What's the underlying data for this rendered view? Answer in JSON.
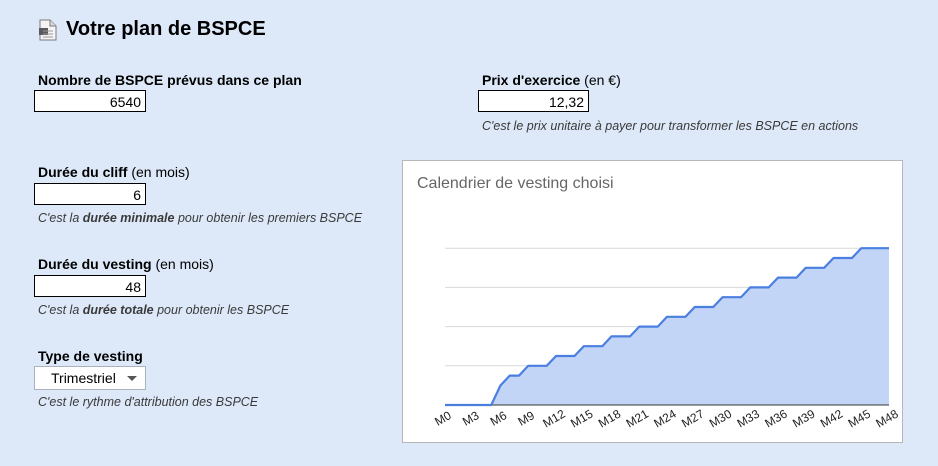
{
  "header": {
    "title": "Votre plan de BSPCE",
    "icon": "document-icon"
  },
  "fields": {
    "nb_bspce": {
      "label": "Nombre de BSPCE prévus dans ce plan",
      "value": "6540"
    },
    "prix": {
      "label": "Prix d'exercice",
      "label_suffix": " (en €)",
      "value": "12,32",
      "hint": "C'est le prix unitaire à payer pour transformer les BSPCE en actions"
    },
    "cliff": {
      "label": "Durée du cliff",
      "label_suffix": " (en mois)",
      "value": "6",
      "hint_pre": "C'est la ",
      "hint_bold": "durée minimale",
      "hint_post": " pour obtenir les premiers BSPCE"
    },
    "vesting": {
      "label": "Durée du vesting",
      "label_suffix": " (en mois)",
      "value": "48",
      "hint_pre": "C'est la ",
      "hint_bold": "durée totale",
      "hint_post": " pour obtenir les BSPCE"
    },
    "type": {
      "label": "Type de vesting",
      "value": "Trimestriel",
      "hint": "C'est le rythme d'attribution des BSPCE"
    }
  },
  "colors": {
    "line": "#4a7fe0",
    "fill": "#c3d5f7",
    "grid": "#d9d9d9",
    "background": "#dde8f8"
  },
  "chart_data": {
    "type": "area",
    "title": "Calendrier de vesting choisi",
    "xlabel": "",
    "ylabel": "",
    "x": [
      "M0",
      "M1",
      "M2",
      "M3",
      "M4",
      "M5",
      "M6",
      "M7",
      "M8",
      "M9",
      "M10",
      "M11",
      "M12",
      "M13",
      "M14",
      "M15",
      "M16",
      "M17",
      "M18",
      "M19",
      "M20",
      "M21",
      "M22",
      "M23",
      "M24",
      "M25",
      "M26",
      "M27",
      "M28",
      "M29",
      "M30",
      "M31",
      "M32",
      "M33",
      "M34",
      "M35",
      "M36",
      "M37",
      "M38",
      "M39",
      "M40",
      "M41",
      "M42",
      "M43",
      "M44",
      "M45",
      "M46",
      "M47",
      "M48"
    ],
    "values": [
      0,
      0,
      0,
      0,
      0,
      0,
      0.125,
      0.1875,
      0.1875,
      0.25,
      0.25,
      0.25,
      0.3125,
      0.3125,
      0.3125,
      0.375,
      0.375,
      0.375,
      0.4375,
      0.4375,
      0.4375,
      0.5,
      0.5,
      0.5,
      0.5625,
      0.5625,
      0.5625,
      0.625,
      0.625,
      0.625,
      0.6875,
      0.6875,
      0.6875,
      0.75,
      0.75,
      0.75,
      0.8125,
      0.8125,
      0.8125,
      0.875,
      0.875,
      0.875,
      0.9375,
      0.9375,
      0.9375,
      1,
      1,
      1,
      1
    ],
    "tick_labels": [
      "M0",
      "M3",
      "M6",
      "M9",
      "M12",
      "M15",
      "M18",
      "M21",
      "M24",
      "M27",
      "M30",
      "M33",
      "M36",
      "M39",
      "M42",
      "M45",
      "M48"
    ],
    "ylim": [
      0,
      1.25
    ],
    "grid": true,
    "legend": "none"
  }
}
